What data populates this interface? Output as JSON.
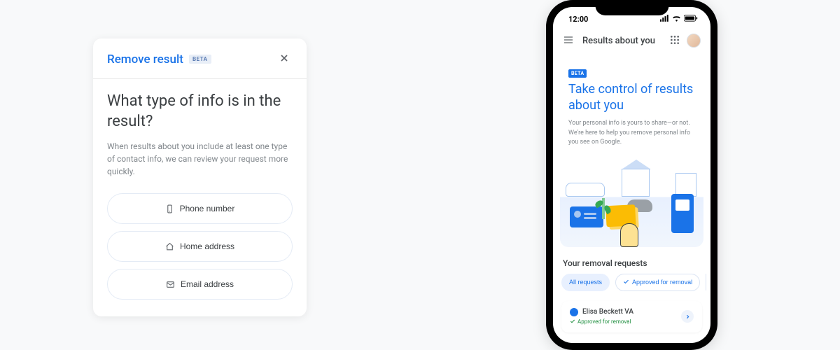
{
  "card": {
    "title": "Remove result",
    "beta_label": "BETA",
    "question": "What type of info is in the result?",
    "subtext": "When results about you include at least one type of contact info, we can review your request more quickly.",
    "options": {
      "phone": "Phone number",
      "home": "Home address",
      "email": "Email address"
    }
  },
  "phone": {
    "status_time": "12:00",
    "app_title": "Results about you",
    "hero": {
      "beta_label": "BETA",
      "title": "Take control of results about you",
      "desc": "Your personal info is yours to share—or not. We're here to help you remove personal info you see on Google."
    },
    "section_title": "Your removal requests",
    "filters": {
      "all": "All requests",
      "approved": "Approved for removal"
    },
    "request": {
      "name": "Elisa Beckett VA",
      "status": "Approved for removal"
    }
  }
}
